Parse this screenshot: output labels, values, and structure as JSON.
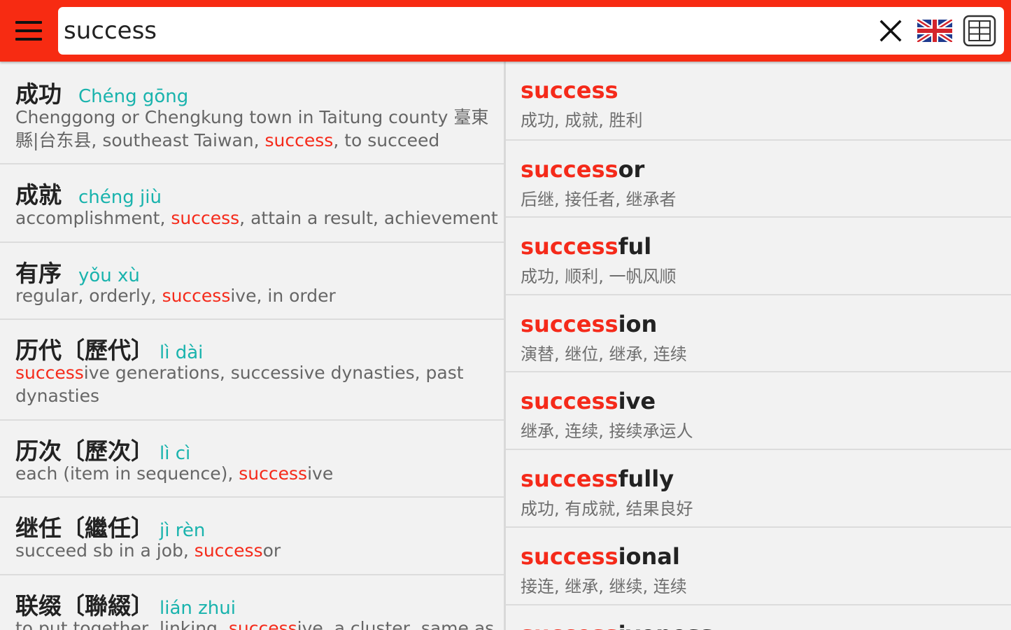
{
  "search": {
    "query": "success"
  },
  "colors": {
    "toolbar": "#f72b12",
    "highlight": "#f52a1a",
    "pinyin": "#19b3ad"
  },
  "icons": {
    "menu": "hamburger-icon",
    "clear": "close-icon",
    "language": "uk-flag-icon",
    "view": "grid-icon"
  },
  "left_results": [
    {
      "hanzi": "成功",
      "pinyin": "Chéng gōng",
      "def": [
        [
          "Chenggong or Chengkung town in Taitung county 臺東縣|台东县, southeast Taiwan, ",
          false
        ],
        [
          "success",
          true
        ],
        [
          ", to succeed",
          false
        ]
      ]
    },
    {
      "hanzi": "成就",
      "pinyin": "chéng jiù",
      "def": [
        [
          "accomplishment, ",
          false
        ],
        [
          "success",
          true
        ],
        [
          ", attain a result, achievement",
          false
        ]
      ]
    },
    {
      "hanzi": "有序",
      "pinyin": "yǒu xù",
      "def": [
        [
          "regular, orderly, ",
          false
        ],
        [
          "success",
          true
        ],
        [
          "ive, in order",
          false
        ]
      ]
    },
    {
      "hanzi": "历代〔歷代〕",
      "pinyin": "lì dài",
      "def": [
        [
          "success",
          true
        ],
        [
          "ive generations, successive dynasties, past dynasties",
          false
        ]
      ]
    },
    {
      "hanzi": "历次〔歷次〕",
      "pinyin": "lì cì",
      "def": [
        [
          "each (item in sequence), ",
          false
        ],
        [
          "success",
          true
        ],
        [
          "ive",
          false
        ]
      ]
    },
    {
      "hanzi": "继任〔繼任〕",
      "pinyin": "jì rèn",
      "def": [
        [
          "succeed sb in a job, ",
          false
        ],
        [
          "success",
          true
        ],
        [
          "or",
          false
        ]
      ]
    },
    {
      "hanzi": "联缀〔聯綴〕",
      "pinyin": "lián zhui",
      "def": [
        [
          "to put together, linking, ",
          false
        ],
        [
          "success",
          true
        ],
        [
          "ive, a cluster, same as",
          false
        ]
      ]
    }
  ],
  "right_results": [
    {
      "prefix": "success",
      "suffix": "",
      "trans": "成功, 成就, 胜利"
    },
    {
      "prefix": "success",
      "suffix": "or",
      "trans": "后继, 接任者, 继承者"
    },
    {
      "prefix": "success",
      "suffix": "ful",
      "trans": "成功, 顺利, 一帆风顺"
    },
    {
      "prefix": "success",
      "suffix": "ion",
      "trans": "演替, 继位, 继承, 连续"
    },
    {
      "prefix": "success",
      "suffix": "ive",
      "trans": "继承, 连续, 接续承运人"
    },
    {
      "prefix": "success",
      "suffix": "fully",
      "trans": "成功, 有成就, 结果良好"
    },
    {
      "prefix": "success",
      "suffix": "ional",
      "trans": "接连, 继承, 继续, 连续"
    },
    {
      "prefix": "success",
      "suffix": "iveness",
      "trans": ""
    }
  ]
}
